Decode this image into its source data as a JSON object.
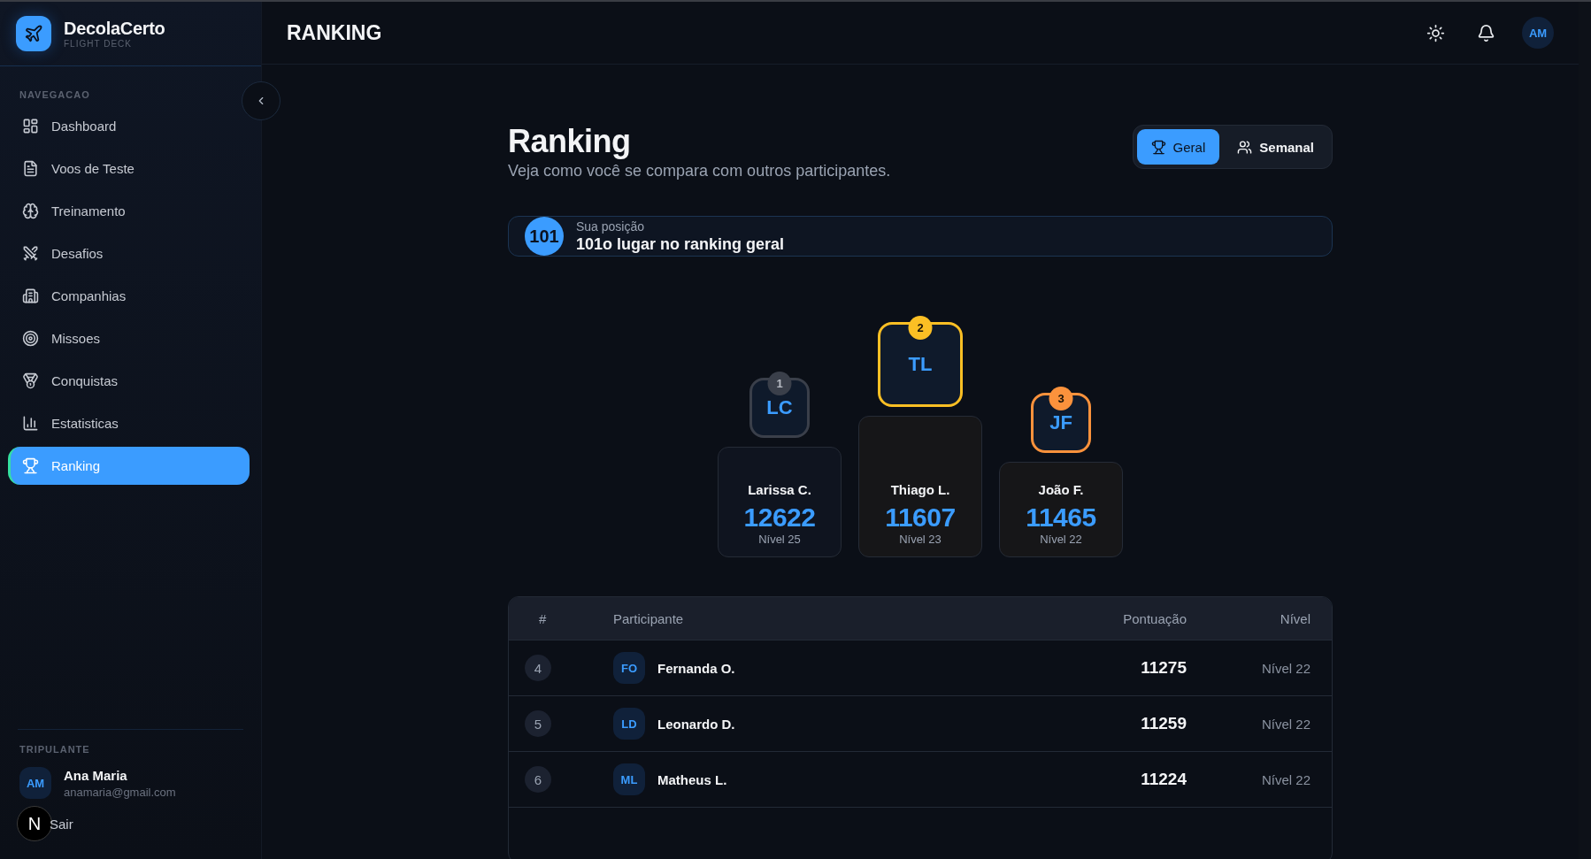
{
  "app": {
    "name": "DecolaCerto",
    "subtitle": "FLIGHT DECK"
  },
  "header": {
    "title": "RANKING",
    "avatar": "AM"
  },
  "sidebar": {
    "section": "NAVEGACAO",
    "items": [
      {
        "label": "Dashboard",
        "selected": false
      },
      {
        "label": "Voos de Teste",
        "selected": false
      },
      {
        "label": "Treinamento",
        "selected": false
      },
      {
        "label": "Desafios",
        "selected": false
      },
      {
        "label": "Companhias",
        "selected": false
      },
      {
        "label": "Missoes",
        "selected": false
      },
      {
        "label": "Conquistas",
        "selected": false
      },
      {
        "label": "Estatisticas",
        "selected": false
      },
      {
        "label": "Ranking",
        "selected": true
      }
    ],
    "user_section": "TRIPULANTE",
    "user": {
      "initials": "AM",
      "name": "Ana Maria",
      "email": "anamaria@gmail.com"
    },
    "logout": "Sair",
    "dev_badge": "N"
  },
  "page": {
    "title": "Ranking",
    "subtitle": "Veja como você se compara com outros participantes.",
    "tabs": [
      {
        "label": "Geral",
        "selected": true
      },
      {
        "label": "Semanal",
        "selected": false
      }
    ]
  },
  "position": {
    "badge": "101",
    "label": "Sua posição",
    "text": "101o lugar no ranking geral"
  },
  "podium": [
    {
      "rank": "1",
      "initials": "LC",
      "name": "Larissa C.",
      "score": "12622",
      "level": "Nível 25",
      "color": "#3a3f4a"
    },
    {
      "rank": "2",
      "initials": "TL",
      "name": "Thiago L.",
      "score": "11607",
      "level": "Nível 23",
      "color": "#fbbf24"
    },
    {
      "rank": "3",
      "initials": "JF",
      "name": "João F.",
      "score": "11465",
      "level": "Nível 22",
      "color": "#fb923c"
    }
  ],
  "table": {
    "columns": [
      "#",
      "Participante",
      "Pontuação",
      "Nível"
    ],
    "rows": [
      {
        "rank": "4",
        "initials": "FO",
        "name": "Fernanda O.",
        "score": "11275",
        "level": "Nível 22"
      },
      {
        "rank": "5",
        "initials": "LD",
        "name": "Leonardo D.",
        "score": "11259",
        "level": "Nível 22"
      },
      {
        "rank": "6",
        "initials": "ML",
        "name": "Matheus L.",
        "score": "11224",
        "level": "Nível 22"
      }
    ]
  }
}
